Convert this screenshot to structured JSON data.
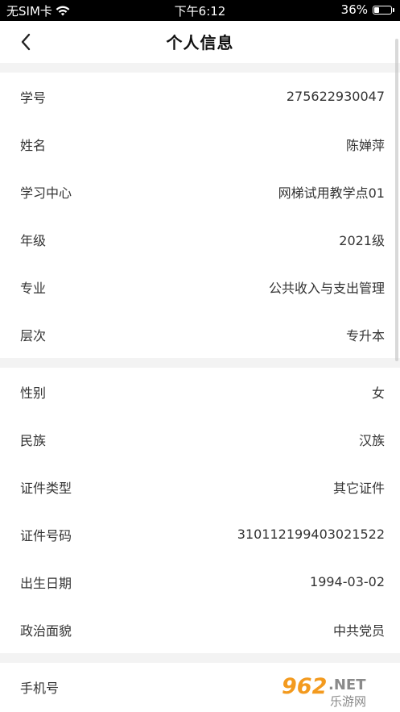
{
  "status_bar": {
    "carrier": "无SIM卡",
    "time": "下午6:12",
    "battery_percent": "36%",
    "battery_level": 0.36
  },
  "nav": {
    "title": "个人信息",
    "back_icon": "chevron-left-icon"
  },
  "section1": [
    {
      "label": "学号",
      "value": "275622930047"
    },
    {
      "label": "姓名",
      "value": "陈婵萍"
    },
    {
      "label": "学习中心",
      "value": "网梯试用教学点01"
    },
    {
      "label": "年级",
      "value": "2021级"
    },
    {
      "label": "专业",
      "value": "公共收入与支出管理"
    },
    {
      "label": "层次",
      "value": "专升本"
    }
  ],
  "section2": [
    {
      "label": "性别",
      "value": "女"
    },
    {
      "label": "民族",
      "value": "汉族"
    },
    {
      "label": "证件类型",
      "value": "其它证件"
    },
    {
      "label": "证件号码",
      "value": "310112199403021522"
    },
    {
      "label": "出生日期",
      "value": "1994-03-02"
    },
    {
      "label": "政治面貌",
      "value": "中共党员"
    }
  ],
  "section3": [
    {
      "label": "手机号",
      "value": ""
    }
  ],
  "watermark": {
    "number": "962",
    "suffix": ".NET",
    "subtitle": "乐游网"
  },
  "colors": {
    "background": "#ffffff",
    "section_gap": "#f3f3f3",
    "status_bar": "#000000",
    "watermark_orange": "#f39a1e"
  }
}
